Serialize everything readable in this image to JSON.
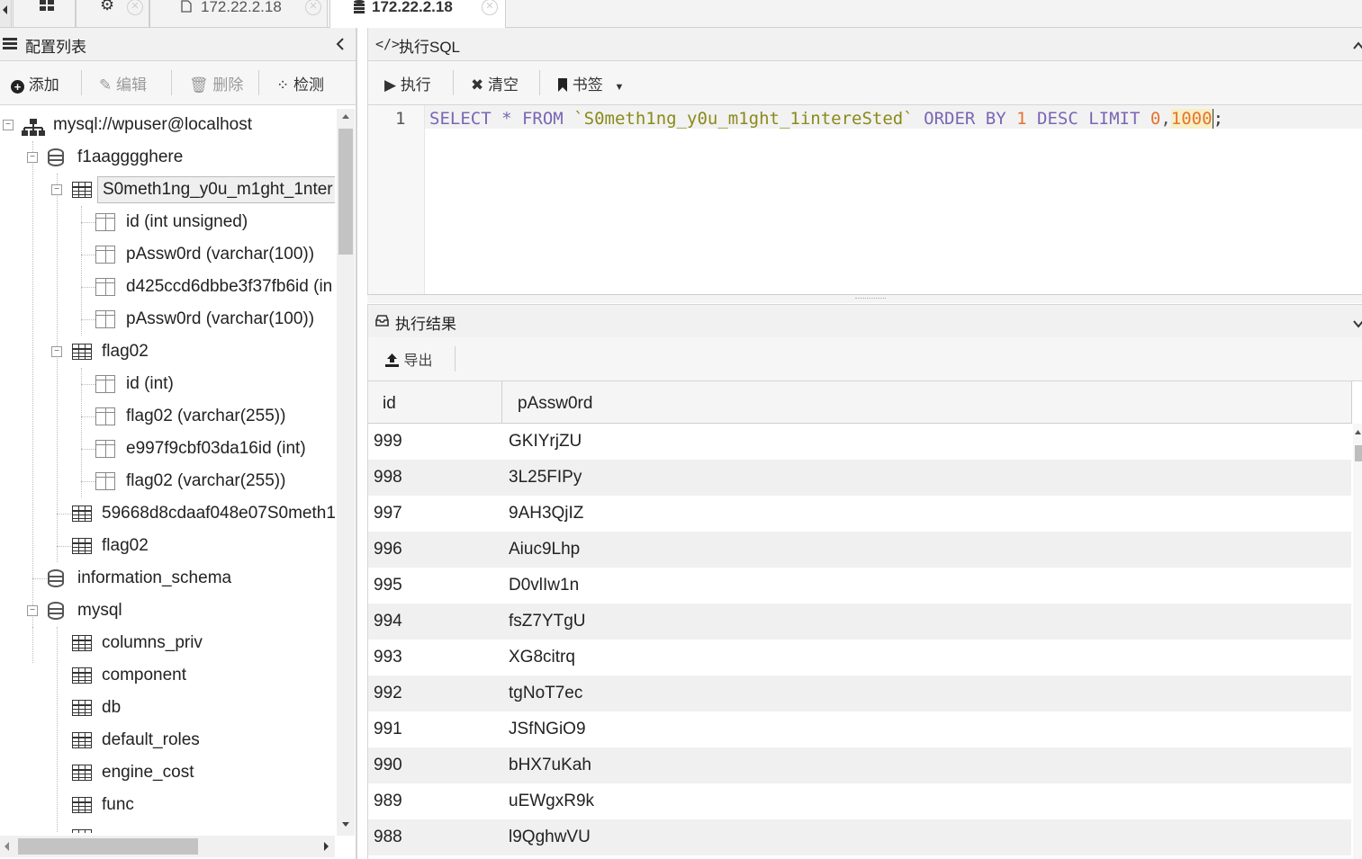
{
  "tabs": [
    {
      "label": "",
      "icon": "grid-icon"
    },
    {
      "label": "",
      "icon": "gear-icon"
    },
    {
      "label": "172.22.2.18",
      "icon": "file-icon"
    },
    {
      "label": "172.22.2.18",
      "icon": "database-icon",
      "active": true
    }
  ],
  "left_panel": {
    "title": "配置列表",
    "toolbar": {
      "add": "添加",
      "edit": "编辑",
      "delete": "删除",
      "detect": "检测"
    },
    "tree": [
      {
        "label": "mysql://wpuser@localhost",
        "type": "connection"
      },
      {
        "label": "f1aagggghere",
        "type": "database"
      },
      {
        "label": "S0meth1ng_y0u_m1ght_1nter",
        "type": "table",
        "selected": true
      },
      {
        "label": "id (int unsigned)",
        "type": "column"
      },
      {
        "label": "pAssw0rd (varchar(100))",
        "type": "column"
      },
      {
        "label": "d425ccd6dbbe3f37fb6id (in",
        "type": "column"
      },
      {
        "label": "pAssw0rd (varchar(100))",
        "type": "column"
      },
      {
        "label": "flag02",
        "type": "table"
      },
      {
        "label": "id (int)",
        "type": "column"
      },
      {
        "label": "flag02 (varchar(255))",
        "type": "column"
      },
      {
        "label": "e997f9cbf03da16id (int)",
        "type": "column"
      },
      {
        "label": "flag02 (varchar(255))",
        "type": "column"
      },
      {
        "label": "59668d8cdaaf048e07S0meth1",
        "type": "table"
      },
      {
        "label": "flag02",
        "type": "table"
      },
      {
        "label": "information_schema",
        "type": "database"
      },
      {
        "label": "mysql",
        "type": "database"
      },
      {
        "label": "columns_priv",
        "type": "table"
      },
      {
        "label": "component",
        "type": "table"
      },
      {
        "label": "db",
        "type": "table"
      },
      {
        "label": "default_roles",
        "type": "table"
      },
      {
        "label": "engine_cost",
        "type": "table"
      },
      {
        "label": "func",
        "type": "table"
      }
    ]
  },
  "sql_panel": {
    "title": "执行SQL",
    "toolbar": {
      "run": "执行",
      "clear": "清空",
      "bookmark": "书签"
    },
    "line_number": "1",
    "query": {
      "kw_select": "SELECT",
      "star": " * ",
      "kw_from": "FROM",
      "table": "`S0meth1ng_y0u_m1ght_1intereSted`",
      "kw_order": "ORDER BY",
      "order_num": "1",
      "kw_desc": "DESC",
      "kw_limit": "LIMIT",
      "offset": "0",
      "comma": ",",
      "limit": "1000",
      "semicolon": ";"
    }
  },
  "result_panel": {
    "title": "执行结果",
    "export": "导出",
    "columns": [
      "id",
      "pAssw0rd"
    ],
    "rows": [
      [
        "999",
        "GKIYrjZU"
      ],
      [
        "998",
        "3L25FIPy"
      ],
      [
        "997",
        "9AH3QjIZ"
      ],
      [
        "996",
        "Aiuc9Lhp"
      ],
      [
        "995",
        "D0vlIw1n"
      ],
      [
        "994",
        "fsZ7YTgU"
      ],
      [
        "993",
        "XG8citrq"
      ],
      [
        "992",
        "tgNoT7ec"
      ],
      [
        "991",
        "JSfNGiO9"
      ],
      [
        "990",
        "bHX7uKah"
      ],
      [
        "989",
        "uEWgxR9k"
      ],
      [
        "988",
        "l9QghwVU"
      ]
    ]
  }
}
